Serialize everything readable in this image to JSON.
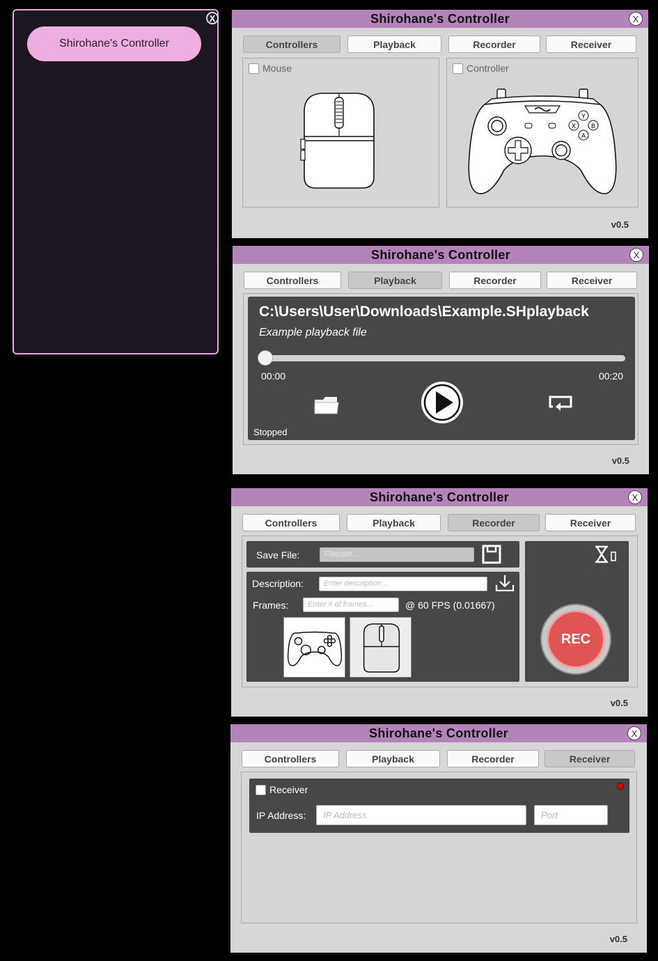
{
  "launcher": {
    "close_label": "X",
    "button_label": "Shirohane's Controller"
  },
  "app": {
    "title": "Shirohane's Controller",
    "close_label": "X",
    "version": "v0.5"
  },
  "tabs": [
    "Controllers",
    "Playback",
    "Recorder",
    "Receiver"
  ],
  "controllers": {
    "mouse_label": "Mouse",
    "controller_label": "Controller"
  },
  "playback": {
    "path": "C:\\Users\\User\\Downloads\\Example.SHplayback",
    "description": "Example playback file",
    "time_current": "00:00",
    "time_total": "00:20",
    "progress": 0,
    "status": "Stopped"
  },
  "recorder": {
    "save_label": "Save File:",
    "filepath_placeholder": "Filepath...",
    "description_label": "Description:",
    "description_placeholder": "Enter description...",
    "frames_label": "Frames:",
    "frames_placeholder": "Enter # of frames...",
    "fps_text": "@ 60 FPS (0.01667)",
    "rec_label": "REC"
  },
  "receiver": {
    "checkbox_label": "Receiver",
    "ip_label": "IP Address:",
    "ip_placeholder": "IP Address",
    "port_placeholder": "Port",
    "status_color": "#e00000"
  },
  "colors": {
    "title_bar": "#b383b9",
    "launcher_border": "#e6a4d8",
    "launcher_button": "#efaee0",
    "rec": "#e05454"
  }
}
